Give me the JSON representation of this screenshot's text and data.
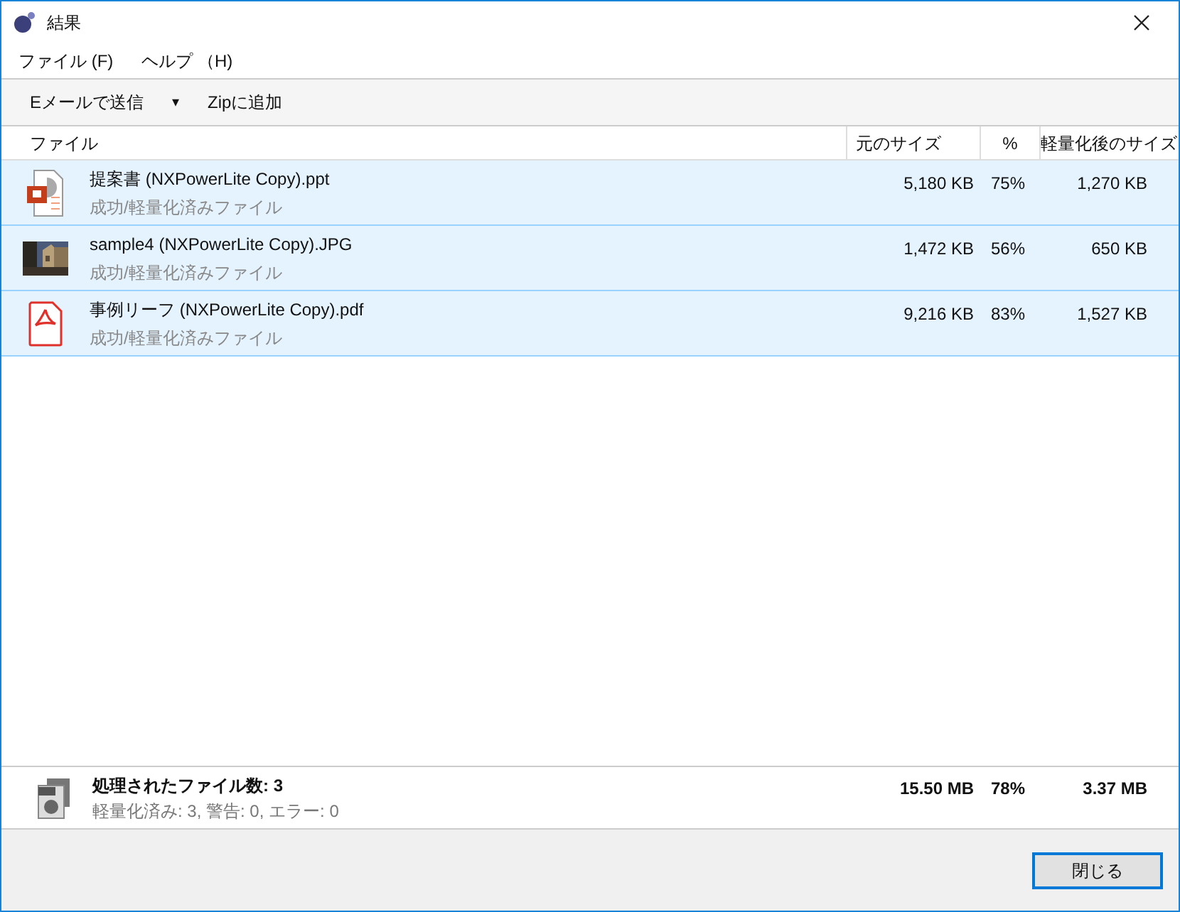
{
  "window": {
    "title": "結果"
  },
  "menu": [
    "ファイル (F)",
    "ヘルプ （H)"
  ],
  "toolbar": {
    "send": "Eメールで送信",
    "dropdown": "▾",
    "zip": "Zipに追加"
  },
  "table": {
    "columns": [
      "ファイル",
      "元のサイズ",
      "%",
      "軽量化後のサイズ"
    ],
    "rows": [
      {
        "kind": "ppt",
        "name": "提案書 (NXPowerLite Copy).ppt",
        "status": "成功/軽量化済みファイル",
        "original": "5,180 KB",
        "percent": "75%",
        "after": "1,270 KB",
        "selected": true
      },
      {
        "name": "sample4 (NXPowerLite Copy).JPG",
        "status": "成功/軽量化済みファイル",
        "original": "1,472 KB",
        "percent": "56%",
        "after": "650 KB",
        "selected": true
      },
      {
        "kind": "pdf",
        "name": "事例リーフ (NXPowerLite Copy).pdf",
        "status": "成功/軽量化済みファイル",
        "original": "9,216 KB",
        "percent": "83%",
        "after": "1,527 KB",
        "selected": true
      }
    ]
  },
  "summary": {
    "title": "処理されたファイル数: 3",
    "detail": "軽量化済み: 3, 警告: 0, エラー: 0",
    "original": "15.50 MB",
    "percent": "78%",
    "after": "3.37 MB"
  },
  "buttons": {
    "close": "閉じる"
  }
}
